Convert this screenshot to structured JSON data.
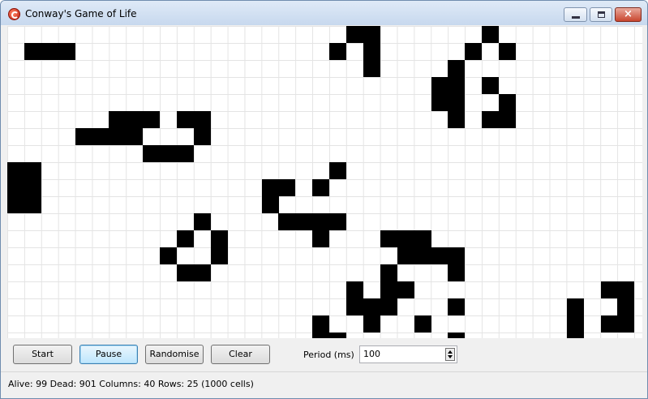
{
  "window": {
    "title": "Conway's Game of Life"
  },
  "controls": {
    "start_label": "Start",
    "pause_label": "Pause",
    "randomise_label": "Randomise",
    "clear_label": "Clear",
    "period_label": "Period (ms)",
    "period_value": "100"
  },
  "status": {
    "text": "Alive: 99 Dead: 901 Columns: 40 Rows: 25 (1000 cells)"
  },
  "grid": {
    "columns": 40,
    "rows": 25,
    "alive_color": "#000000",
    "grid_line_color": "#e4e4e4",
    "alive_cells": [
      [
        20,
        0
      ],
      [
        21,
        0
      ],
      [
        28,
        0
      ],
      [
        1,
        1
      ],
      [
        2,
        1
      ],
      [
        3,
        1
      ],
      [
        19,
        1
      ],
      [
        21,
        1
      ],
      [
        27,
        1
      ],
      [
        29,
        1
      ],
      [
        21,
        2
      ],
      [
        26,
        2
      ],
      [
        25,
        3
      ],
      [
        26,
        3
      ],
      [
        28,
        3
      ],
      [
        25,
        4
      ],
      [
        26,
        4
      ],
      [
        29,
        4
      ],
      [
        6,
        5
      ],
      [
        7,
        5
      ],
      [
        8,
        5
      ],
      [
        10,
        5
      ],
      [
        11,
        5
      ],
      [
        26,
        5
      ],
      [
        28,
        5
      ],
      [
        29,
        5
      ],
      [
        4,
        6
      ],
      [
        5,
        6
      ],
      [
        6,
        6
      ],
      [
        7,
        6
      ],
      [
        11,
        6
      ],
      [
        8,
        7
      ],
      [
        9,
        7
      ],
      [
        10,
        7
      ],
      [
        0,
        8
      ],
      [
        1,
        8
      ],
      [
        19,
        8
      ],
      [
        0,
        9
      ],
      [
        1,
        9
      ],
      [
        15,
        9
      ],
      [
        16,
        9
      ],
      [
        18,
        9
      ],
      [
        0,
        10
      ],
      [
        1,
        10
      ],
      [
        15,
        10
      ],
      [
        11,
        11
      ],
      [
        16,
        11
      ],
      [
        17,
        11
      ],
      [
        18,
        11
      ],
      [
        19,
        11
      ],
      [
        10,
        12
      ],
      [
        12,
        12
      ],
      [
        18,
        12
      ],
      [
        22,
        12
      ],
      [
        23,
        12
      ],
      [
        24,
        12
      ],
      [
        9,
        13
      ],
      [
        12,
        13
      ],
      [
        23,
        13
      ],
      [
        24,
        13
      ],
      [
        25,
        13
      ],
      [
        26,
        13
      ],
      [
        10,
        14
      ],
      [
        11,
        14
      ],
      [
        22,
        14
      ],
      [
        26,
        14
      ],
      [
        20,
        15
      ],
      [
        22,
        15
      ],
      [
        23,
        15
      ],
      [
        35,
        15
      ],
      [
        36,
        15
      ],
      [
        20,
        16
      ],
      [
        21,
        16
      ],
      [
        22,
        16
      ],
      [
        26,
        16
      ],
      [
        33,
        16
      ],
      [
        36,
        16
      ],
      [
        18,
        17
      ],
      [
        21,
        17
      ],
      [
        24,
        17
      ],
      [
        33,
        17
      ],
      [
        35,
        17
      ],
      [
        36,
        17
      ],
      [
        18,
        18
      ],
      [
        19,
        18
      ],
      [
        26,
        18
      ],
      [
        33,
        18
      ]
    ]
  }
}
